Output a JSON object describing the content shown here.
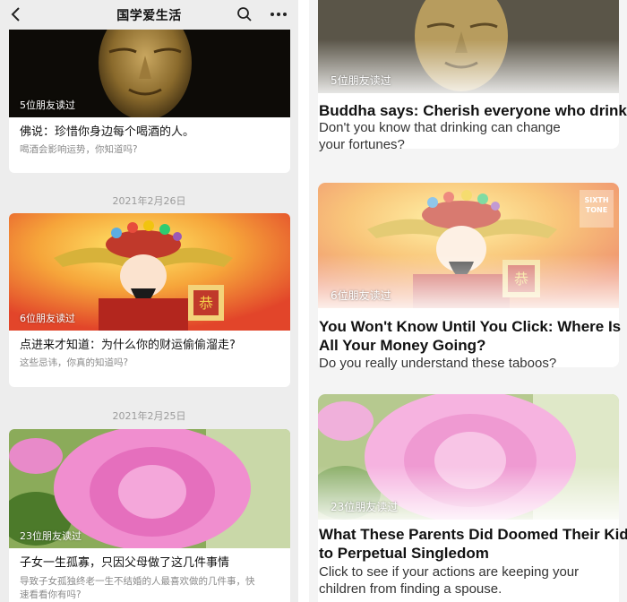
{
  "left": {
    "nav": {
      "title": "国学爱生活"
    },
    "cards": [
      {
        "readers": "5位朋友读过",
        "title": "佛说：珍惜你身边每个喝酒的人。",
        "subtitle": "喝酒会影响运势，你知道吗?"
      },
      {
        "date": "2021年2月26日",
        "readers": "6位朋友读过",
        "title": "点进来才知道：为什么你的财运偷偷溜走?",
        "subtitle": "这些忌讳，你真的知道吗?"
      },
      {
        "date": "2021年2月25日",
        "readers": "23位朋友读过",
        "title": "子女一生孤寡，只因父母做了这几件事情",
        "subtitle_line1": "导致子女孤独终老一生不结婚的人最喜欢做的几件事，快",
        "subtitle_line2": "速看看你有吗?"
      }
    ]
  },
  "right": {
    "cards": [
      {
        "readers": "5位朋友读过",
        "title": "Buddha says: Cherish everyone who drinks.",
        "sub1": "Don't you know that drinking can change",
        "sub2": "your fortunes?"
      },
      {
        "readers": "6位朋友读过",
        "title1": "You Won't Know Until You Click: Where Is",
        "title2": "All Your Money Going?",
        "sub1": "Do you really understand these taboos?",
        "watermark1": "SIXTH",
        "watermark2": "TONE"
      },
      {
        "readers": "23位朋友读过",
        "title1": "What These Parents Did Doomed Their Kids",
        "title2": "to Perpetual Singledom",
        "sub1": "Click to see if your actions are keeping your",
        "sub2": "children from finding a spouse."
      }
    ]
  },
  "colors": {
    "nav_bg": "#ededed",
    "card_bg": "#ffffff",
    "meta_text": "#8a8a8a"
  }
}
